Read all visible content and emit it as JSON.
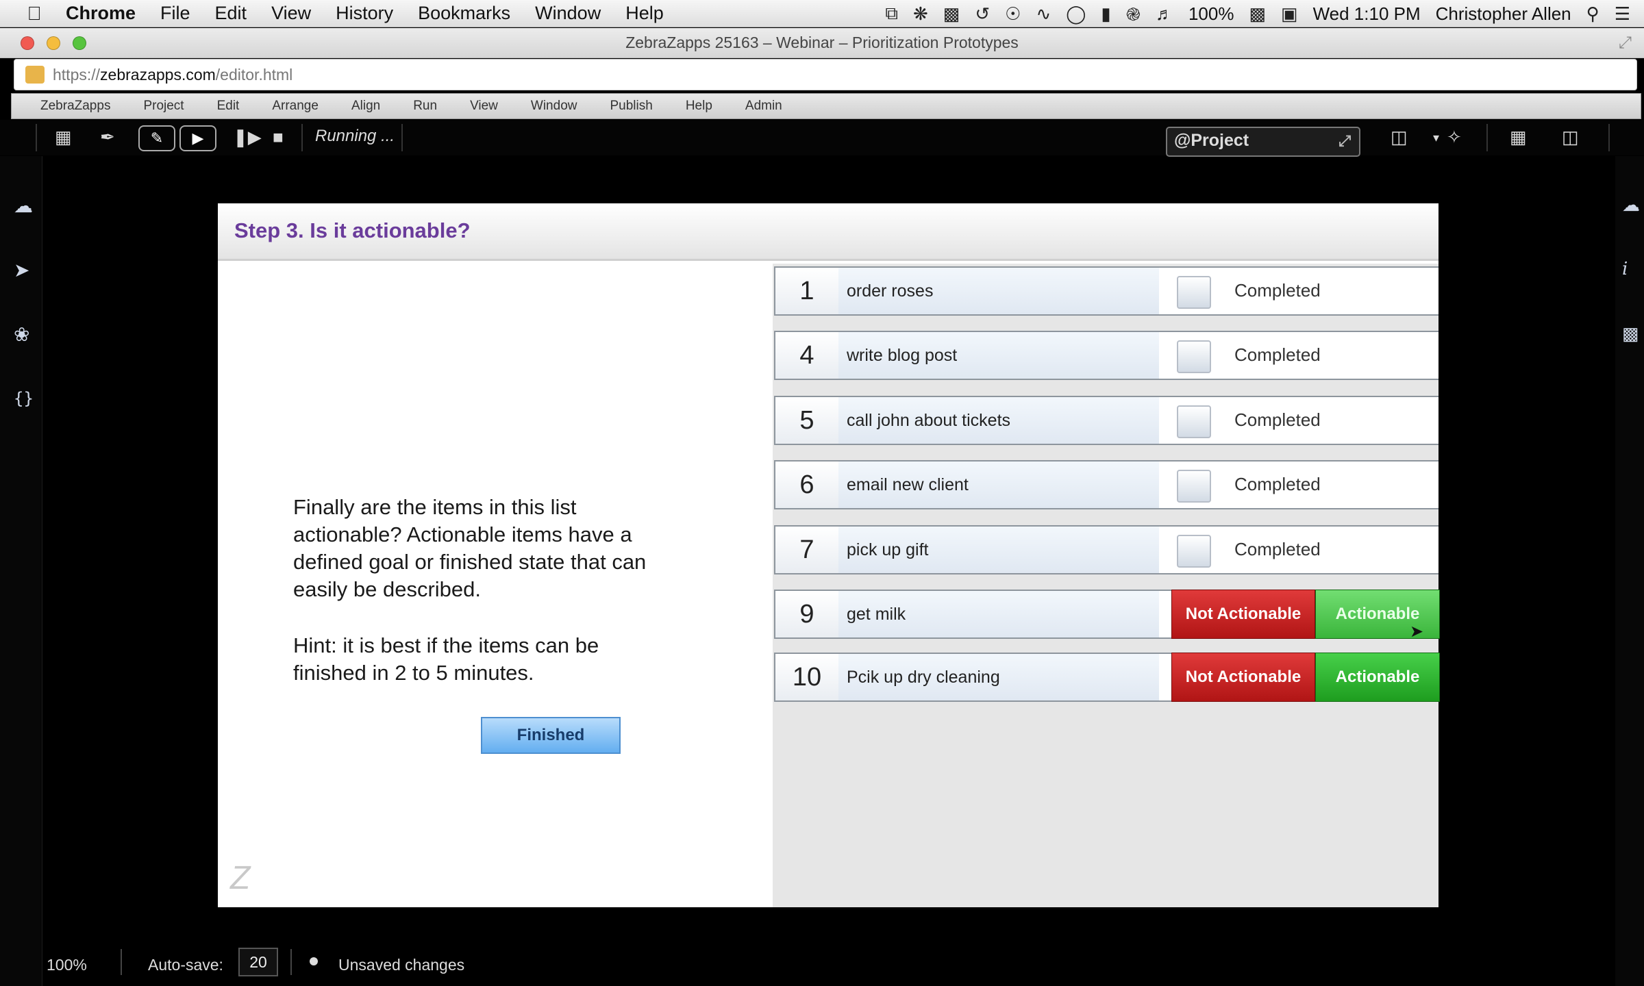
{
  "menubar": {
    "app": "Chrome",
    "items": [
      "File",
      "Edit",
      "View",
      "History",
      "Bookmarks",
      "Window",
      "Help"
    ],
    "battery": "100%",
    "clock": "Wed 1:10 PM",
    "user": "Christopher Allen"
  },
  "window": {
    "title": "ZebraZapps 25163 – Webinar – Prioritization Prototypes",
    "url_scheme": "https://",
    "url_host": "zebrazapps.com",
    "url_path": "/editor.html"
  },
  "appmenu": {
    "items": [
      "ZebraZapps",
      "Project",
      "Edit",
      "Arrange",
      "Align",
      "Run",
      "View",
      "Window",
      "Publish",
      "Help",
      "Admin"
    ]
  },
  "toolbar": {
    "status": "Running ...",
    "project": "@Project"
  },
  "stage": {
    "title": "Step 3. Is it actionable?",
    "instructions": "Finally are the items in this list actionable? Actionable items have a defined goal or finished state that can easily be described.",
    "hint": "Hint: it is best if the items can be finished in 2 to 5 minutes.",
    "finished_label": "Finished",
    "rows": [
      {
        "num": "1",
        "text": "order roses",
        "state": "Completed"
      },
      {
        "num": "4",
        "text": "write blog post",
        "state": "Completed"
      },
      {
        "num": "5",
        "text": "call john about tickets",
        "state": "Completed"
      },
      {
        "num": "6",
        "text": "email new client",
        "state": "Completed"
      },
      {
        "num": "7",
        "text": "pick up gift",
        "state": "Completed"
      },
      {
        "num": "9",
        "text": "get milk",
        "not_label": "Not Actionable",
        "act_label": "Actionable"
      },
      {
        "num": "10",
        "text": "Pcik up dry cleaning",
        "not_label": "Not Actionable",
        "act_label": "Actionable"
      }
    ]
  },
  "statusbar": {
    "zoom": "100%",
    "autosave_label": "Auto-save:",
    "autosave_value": "20",
    "unsaved": "Unsaved changes"
  },
  "colors": {
    "title_purple": "#6a3c9b",
    "not_actionable_red": "#c62020",
    "actionable_green": "#2fb12f",
    "finished_blue": "#63aef0"
  }
}
